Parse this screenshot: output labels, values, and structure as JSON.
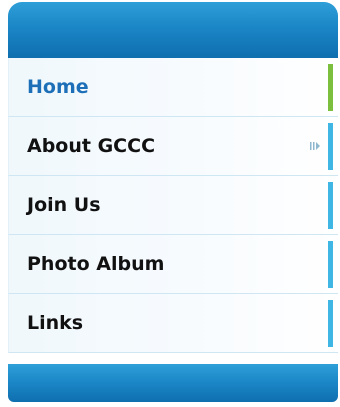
{
  "nav": {
    "items": [
      {
        "label": "Home",
        "active": true
      },
      {
        "label": "About GCCC",
        "has_submenu": true
      },
      {
        "label": "Join Us"
      },
      {
        "label": "Photo Album"
      },
      {
        "label": "Links"
      }
    ]
  },
  "icons": {
    "submenu": "submenu-arrow-icon"
  },
  "colors": {
    "header": "#1b86c6",
    "active_text": "#1d6fb8",
    "text": "#111111",
    "active_marker": "#7cbf3e",
    "marker": "#3fb6e3"
  }
}
